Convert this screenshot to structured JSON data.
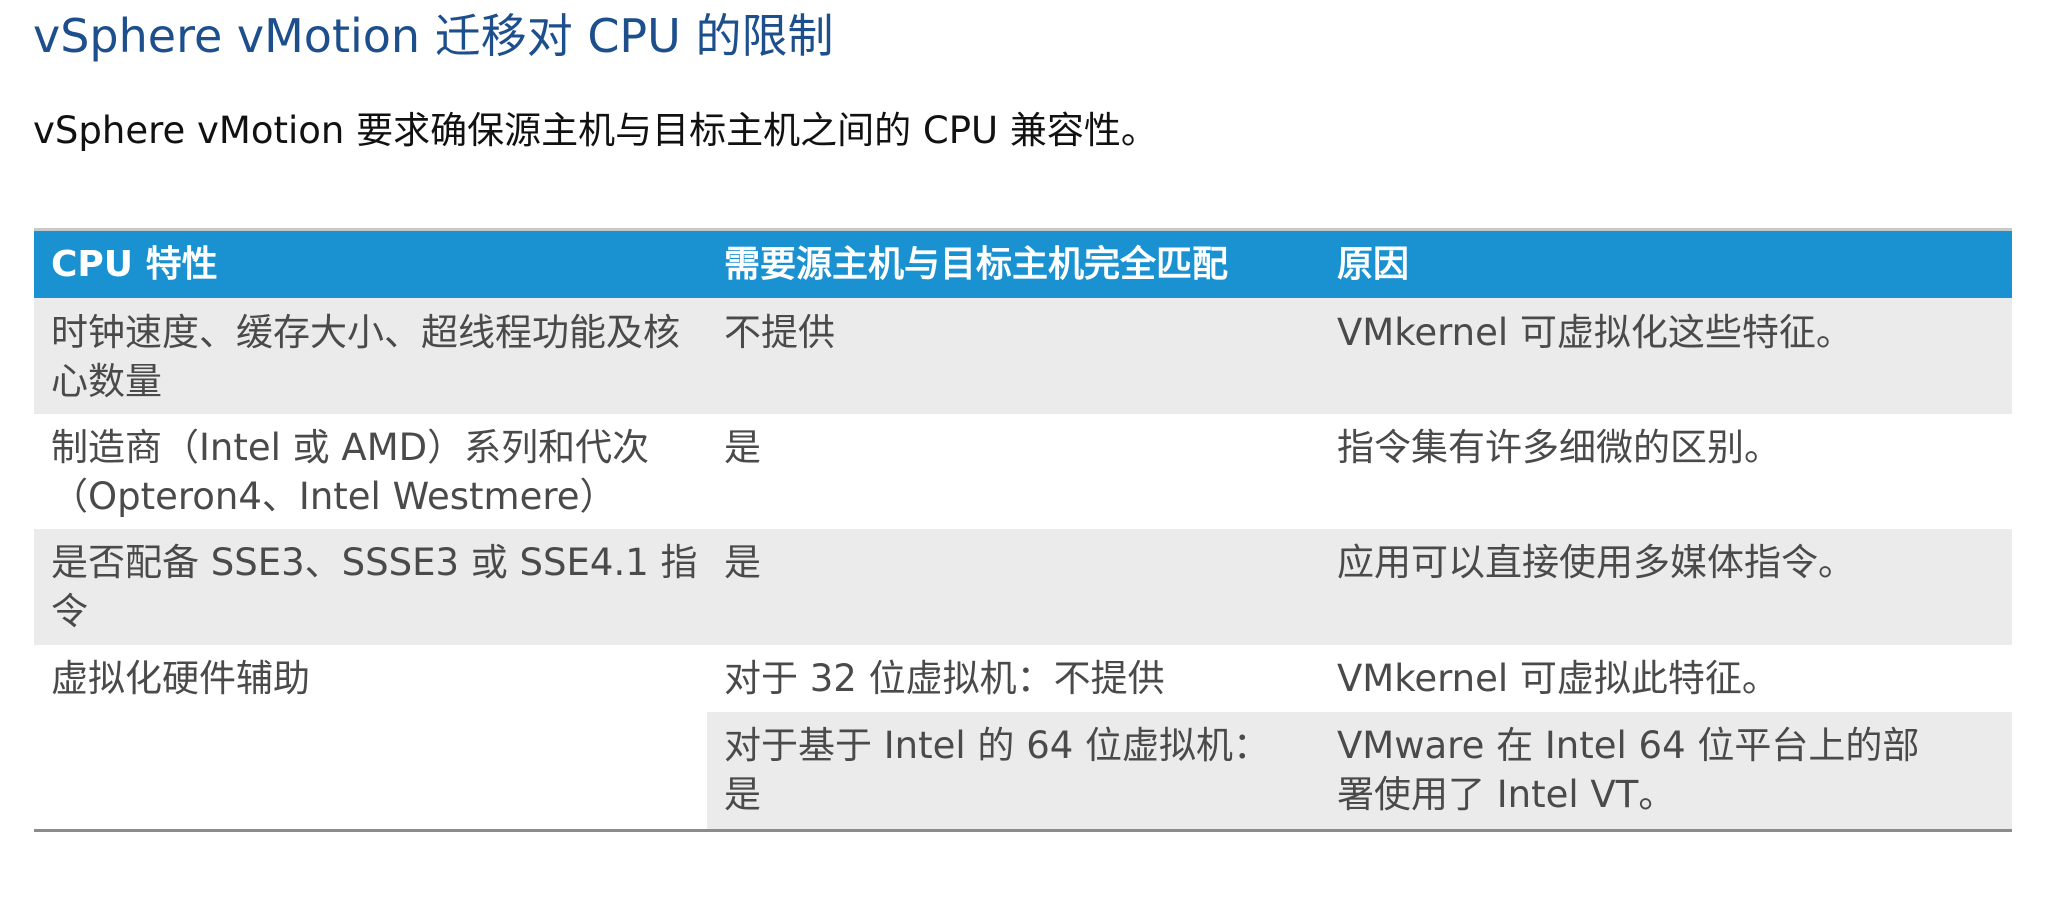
{
  "title": "vSphere vMotion 迁移对 CPU 的限制",
  "subtitle": "vSphere vMotion 要求确保源主机与目标主机之间的 CPU 兼容性。",
  "table": {
    "headers": [
      "CPU 特性",
      "需要源主机与目标主机完全匹配",
      "原因"
    ],
    "rows": [
      {
        "feature": "时钟速度、缓存大小、超线程功能及核心数量",
        "match": "不提供",
        "reason": "VMkernel 可虚拟化这些特征。"
      },
      {
        "feature": "制造商（Intel 或 AMD）系列和代次（Opteron4、Intel Westmere）",
        "match": "是",
        "reason": "指令集有许多细微的区别。"
      },
      {
        "feature": "是否配备 SSE3、SSSE3 或 SSE4.1 指令",
        "match": "是",
        "reason": "应用可以直接使用多媒体指令。"
      },
      {
        "feature": "虚拟化硬件辅助",
        "sub_rows": [
          {
            "match": "对于 32 位虚拟机：不提供",
            "reason": "VMkernel 可虚拟此特征。"
          },
          {
            "match_line1": "对于基于 Intel 的 64 位虚拟机：",
            "match_line2": "是",
            "reason_line1": "VMware 在 Intel 64 位平台上的部",
            "reason_line2": "署使用了 Intel VT。"
          }
        ]
      }
    ]
  }
}
